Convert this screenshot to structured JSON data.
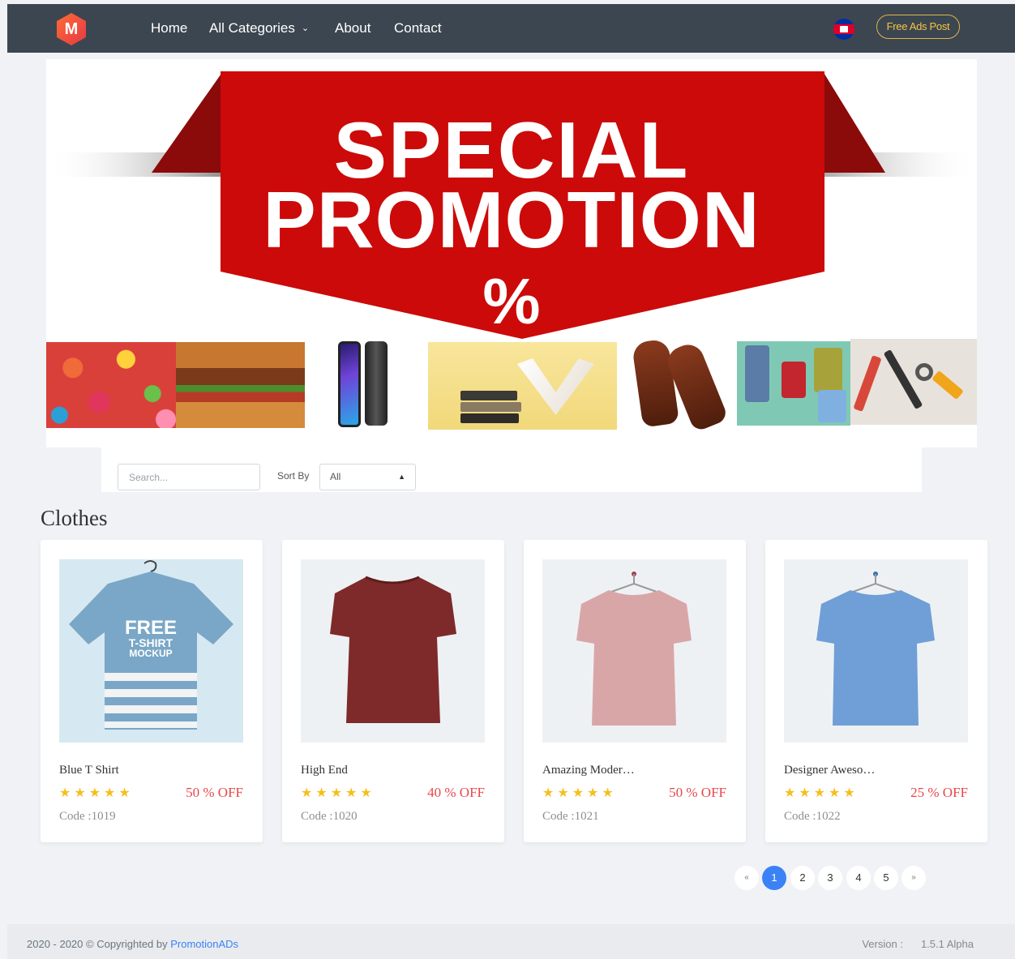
{
  "nav": {
    "logo_letter": "M",
    "links": [
      "Home",
      "All Categories",
      "About",
      "Contact"
    ],
    "cta_label": "Free Ads Post",
    "flag": "cambodia-flag-icon",
    "accent": "#f4c542",
    "bg": "#3c4650"
  },
  "banner": {
    "line1": "SPECIAL",
    "line2": "PROMOTION",
    "line3": "%",
    "ribbon_color": "#cc0a0a"
  },
  "filter": {
    "search_placeholder": "Search...",
    "sort_label": "Sort By",
    "sort_value": "All"
  },
  "section": {
    "title": "Clothes"
  },
  "products": [
    {
      "name": "Blue T Shirt",
      "discount": "50 % OFF",
      "code": "Code :1019",
      "rating": 5,
      "stars": "★★★★★",
      "color": "#7aa7c7"
    },
    {
      "name": "High End",
      "discount": "40 % OFF",
      "code": "Code :1020",
      "rating": 5,
      "stars": "★★★★★",
      "color": "#7e2a2a"
    },
    {
      "name": "Amazing Moder…",
      "discount": "50 % OFF",
      "code": "Code :1021",
      "rating": 5,
      "stars": "★★★★★",
      "color": "#d9a6a8"
    },
    {
      "name": "Designer Aweso…",
      "discount": "25 % OFF",
      "code": "Code :1022",
      "rating": 5,
      "stars": "★★★★★",
      "color": "#6f9fd6"
    }
  ],
  "product_image_text": {
    "line1": "FREE",
    "line2": "T-SHIRT",
    "line3": "MOCKUP"
  },
  "pagination": {
    "prev": "«",
    "pages": [
      "1",
      "2",
      "3",
      "4",
      "5"
    ],
    "next": "»",
    "active": 1
  },
  "footer": {
    "copyright_prefix": "2020 - 2020 © Copyrighted by ",
    "brand": "PromotionADs",
    "version_label": "Version :",
    "version": "1.5.1 Alpha"
  }
}
